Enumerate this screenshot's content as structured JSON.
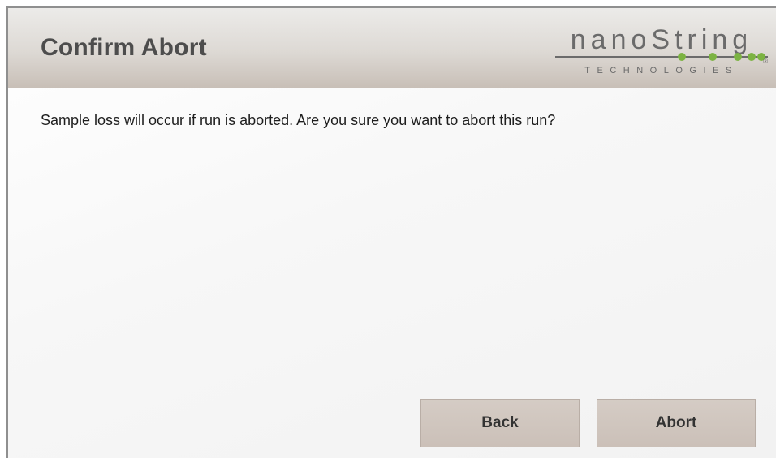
{
  "dialog": {
    "title": "Confirm Abort",
    "message": "Sample loss will occur if run is aborted. Are you sure you want to abort this run?"
  },
  "logo": {
    "wordmark": "nanoString",
    "subtitle": "TECHNOLOGIES",
    "registered": "®"
  },
  "buttons": {
    "back_label": "Back",
    "abort_label": "Abort"
  },
  "colors": {
    "header": "#ddd9d4",
    "button": "#cfc5be",
    "logo_text": "#6b6b6b",
    "logo_accent": "#7cb342"
  }
}
